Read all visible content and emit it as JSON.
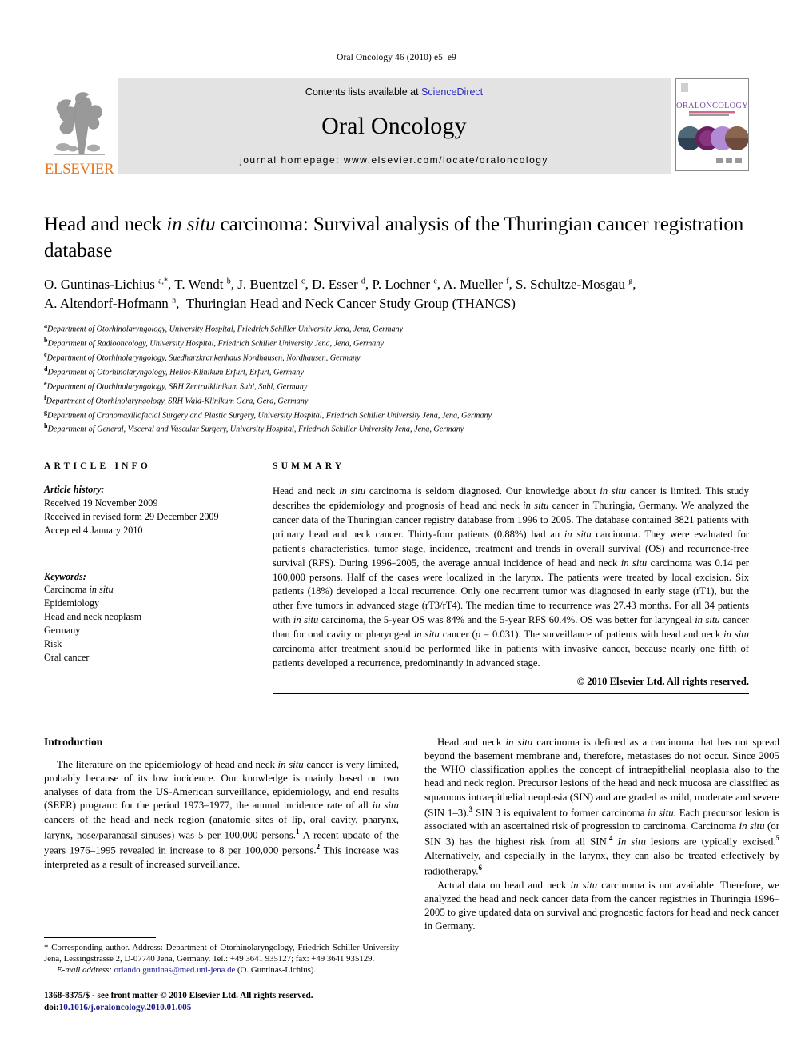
{
  "running_head": "Oral Oncology 46 (2010) e5–e9",
  "masthead": {
    "publisher_wordmark": "ELSEVIER",
    "contents_prefix": "Contents lists available at ",
    "contents_link": "ScienceDirect",
    "journal_name": "Oral Oncology",
    "homepage_line": "journal homepage: www.elsevier.com/locate/oraloncology",
    "cover_title": "ORAL ONCOLOGY",
    "colors": {
      "elsevier_orange": "#E87722",
      "link_blue": "#2b2bbf",
      "banner_gray": "#e3e3e3",
      "cover_purple": "#7a4b9c"
    }
  },
  "article": {
    "title_part1": "Head and neck ",
    "title_italic": "in situ",
    "title_part2": " carcinoma: Survival analysis of the Thuringian cancer registration database",
    "authors_html": "O. Guntinas-Lichius a,*, T. Wendt b, J. Buentzel c, D. Esser d, P. Lochner e, A. Mueller f, S. Schultze-Mosgau g, A. Altendorf-Hofmann h, Thuringian Head and Neck Cancer Study Group (THANCS)",
    "affiliations": [
      {
        "mark": "a",
        "text": "Department of Otorhinolaryngology, University Hospital, Friedrich Schiller University Jena, Jena, Germany"
      },
      {
        "mark": "b",
        "text": "Department of Radiooncology, University Hospital, Friedrich Schiller University Jena, Jena, Germany"
      },
      {
        "mark": "c",
        "text": "Department of Otorhinolaryngology, Suedharzkrankenhaus Nordhausen, Nordhausen, Germany"
      },
      {
        "mark": "d",
        "text": "Department of Otorhinolaryngology, Helios-Klinikum Erfurt, Erfurt, Germany"
      },
      {
        "mark": "e",
        "text": "Department of Otorhinolaryngology, SRH Zentralklinikum Suhl, Suhl, Germany"
      },
      {
        "mark": "f",
        "text": "Department of Otorhinolaryngology, SRH Wald-Klinikum Gera, Gera, Germany"
      },
      {
        "mark": "g",
        "text": "Department of Cranomaxillofacial Surgery and Plastic Surgery, University Hospital, Friedrich Schiller University Jena, Jena, Germany"
      },
      {
        "mark": "h",
        "text": "Department of General, Visceral and Vascular Surgery, University Hospital, Friedrich Schiller University Jena, Jena, Germany"
      }
    ]
  },
  "article_info": {
    "heading": "ARTICLE INFO",
    "history_label": "Article history:",
    "history": [
      "Received 19 November 2009",
      "Received in revised form 29 December 2009",
      "Accepted 4 January 2010"
    ],
    "keywords_label": "Keywords:",
    "keywords": [
      "Carcinoma in situ",
      "Epidemiology",
      "Head and neck neoplasm",
      "Germany",
      "Risk",
      "Oral cancer"
    ]
  },
  "summary": {
    "heading": "SUMMARY",
    "text": "Head and neck in situ carcinoma is seldom diagnosed. Our knowledge about in situ cancer is limited. This study describes the epidemiology and prognosis of head and neck in situ cancer in Thuringia, Germany. We analyzed the cancer data of the Thuringian cancer registry database from 1996 to 2005. The database contained 3821 patients with primary head and neck cancer. Thirty-four patients (0.88%) had an in situ carcinoma. They were evaluated for patient's characteristics, tumor stage, incidence, treatment and trends in overall survival (OS) and recurrence-free survival (RFS). During 1996–2005, the average annual incidence of head and neck in situ carcinoma was 0.14 per 100,000 persons. Half of the cases were localized in the larynx. The patients were treated by local excision. Six patients (18%) developed a local recurrence. Only one recurrent tumor was diagnosed in early stage (rT1), but the other five tumors in advanced stage (rT3/rT4). The median time to recurrence was 27.43 months. For all 34 patients with in situ carcinoma, the 5-year OS was 84% and the 5-year RFS 60.4%. OS was better for laryngeal in situ cancer than for oral cavity or pharyngeal in situ cancer (p = 0.031). The surveillance of patients with head and neck in situ carcinoma after treatment should be performed like in patients with invasive cancer, because nearly one fifth of patients developed a recurrence, predominantly in advanced stage.",
    "copyright": "© 2010 Elsevier Ltd. All rights reserved."
  },
  "introduction": {
    "heading": "Introduction",
    "paragraph_1": "The literature on the epidemiology of head and neck in situ cancer is very limited, probably because of its low incidence. Our knowledge is mainly based on two analyses of data from the US-American surveillance, epidemiology, and end results (SEER) program: for the period 1973–1977, the annual incidence rate of all in situ cancers of the head and neck region (anatomic sites of lip, oral cavity, pharynx, larynx, nose/paranasal sinuses) was 5 per 100,000 persons.1 A recent update of the years 1976–1995 revealed in increase to 8 per 100,000 persons.2 This increase was interpreted as a result of increased surveillance.",
    "paragraph_2": "Head and neck in situ carcinoma is defined as a carcinoma that has not spread beyond the basement membrane and, therefore, metastases do not occur. Since 2005 the WHO classification applies the concept of intraepithelial neoplasia also to the head and neck region. Precursor lesions of the head and neck mucosa are classified as squamous intraepithelial neoplasia (SIN) and are graded as mild, moderate and severe (SIN 1–3).3 SIN 3 is equivalent to former carcinoma in situ. Each precursor lesion is associated with an ascertained risk of progression to carcinoma. Carcinoma in situ (or SIN 3) has the highest risk from all SIN.4 In situ lesions are typically excised.5 Alternatively, and especially in the larynx, they can also be treated effectively by radiotherapy.6",
    "paragraph_3": "Actual data on head and neck in situ carcinoma is not available. Therefore, we analyzed the head and neck cancer data from the cancer registries in Thuringia 1996–2005 to give updated data on survival and prognostic factors for head and neck cancer in Germany."
  },
  "footnote": {
    "corresponding": "* Corresponding author. Address: Department of Otorhinolaryngology, Friedrich Schiller University Jena, Lessingstrasse 2, D-07740 Jena, Germany. Tel.: +49 3641 935127; fax: +49 3641 935129.",
    "email_label": "E-mail address:",
    "email": "orlando.guntinas@med.uni-jena.de",
    "email_owner": "(O. Guntinas-Lichius).",
    "issn_line": "1368-8375/$ - see front matter © 2010 Elsevier Ltd. All rights reserved.",
    "doi_label": "doi:",
    "doi": "10.1016/j.oraloncology.2010.01.005"
  }
}
